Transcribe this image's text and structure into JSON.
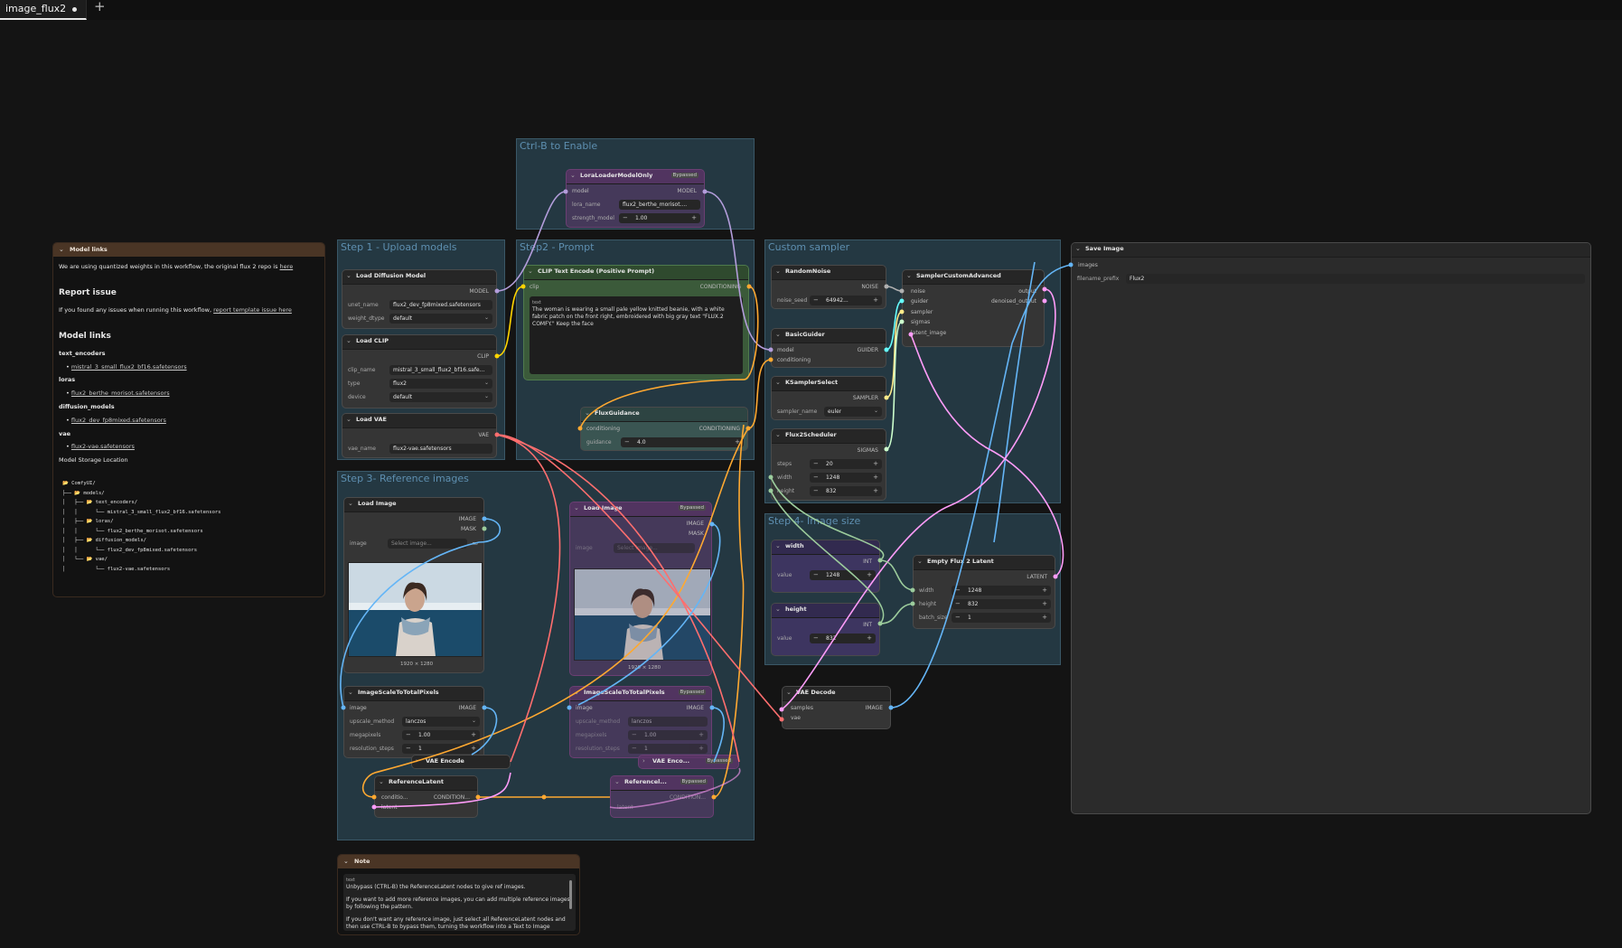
{
  "tab": {
    "title": "image_flux2",
    "add": "+"
  },
  "groups": {
    "enable": "Ctrl-B to Enable",
    "step1": "Step 1 - Upload models",
    "step2": "Step2 - Prompt",
    "custom_sampler": "Custom sampler",
    "step3": "Step 3- Reference images",
    "step4": "Step 4- Image size"
  },
  "model_links_note": {
    "title": "Model links",
    "intro_pre": "We are using quantized weights in this workflow, the original flux 2 repo is",
    "intro_link": "here",
    "report_heading": "Report issue",
    "report_pre": "If you found any issues when running this workflow,",
    "report_link": "report template issue here",
    "links_heading": "Model links",
    "text_encoders_label": "text_encoders",
    "text_encoders_file": "mistral_3_small_flux2_bf16.safetensors",
    "loras_label": "loras",
    "loras_file": "flux2_berthe_morisot.safetensors",
    "diffusion_label": "diffusion_models",
    "diffusion_file": "flux2_dev_fp8mixed.safetensors",
    "vae_label": "vae",
    "vae_file": "flux2-vae.safetensors",
    "storage_label": "Model Storage Location",
    "tree": "📂 ComfyUI/\n├── 📂 models/\n│   ├── 📂 text_encoders/\n│   │      └── mistral_3_small_flux2_bf16.safetensors\n│   ├── 📂 loras/\n│   │      └── flux2_berthe_morisot.safetensors\n│   ├── 📂 diffusion_models/\n│   │      └── flux2_dev_fp8mixed.safetensors\n│   └── 📂 vae/\n│          └── flux2-vae.safetensors"
  },
  "lora": {
    "title": "LoraLoaderModelOnly",
    "badge": "Bypassed",
    "in_model": "model",
    "out_model": "MODEL",
    "lora_name_label": "lora_name",
    "lora_name": "flux2_berthe_morisot....",
    "strength_label": "strength_model",
    "strength": "1.00"
  },
  "load_diffusion": {
    "title": "Load Diffusion Model",
    "out": "MODEL",
    "unet_label": "unet_name",
    "unet": "flux2_dev_fp8mixed.safetensors",
    "dtype_label": "weight_dtype",
    "dtype": "default"
  },
  "load_clip": {
    "title": "Load CLIP",
    "out": "CLIP",
    "name_label": "clip_name",
    "name": "mistral_3_small_flux2_bf16.safe...",
    "type_label": "type",
    "type": "flux2",
    "device_label": "device",
    "device": "default"
  },
  "load_vae": {
    "title": "Load VAE",
    "out": "VAE",
    "name_label": "vae_name",
    "name": "flux2-vae.safetensors"
  },
  "clip_text": {
    "title": "CLIP Text Encode (Positive Prompt)",
    "in": "clip",
    "out": "CONDITIONING",
    "text_label": "text",
    "text": "The woman is wearing a small pale yellow knitted beanie, with a white fabric patch on the front right, embroidered with big gray text \"FLUX.2 COMFY.\" Keep the face"
  },
  "flux_guidance": {
    "title": "FluxGuidance",
    "in": "conditioning",
    "out": "CONDITIONING",
    "label": "guidance",
    "value": "4.0"
  },
  "random_noise": {
    "title": "RandomNoise",
    "out": "NOISE",
    "label": "noise_seed",
    "value": "64942..."
  },
  "basic_guider": {
    "title": "BasicGuider",
    "in_model": "model",
    "in_cond": "conditioning",
    "out": "GUIDER"
  },
  "ksampler_select": {
    "title": "KSamplerSelect",
    "out": "SAMPLER",
    "label": "sampler_name",
    "value": "euler"
  },
  "flux2_scheduler": {
    "title": "Flux2Scheduler",
    "out": "SIGMAS",
    "steps_label": "steps",
    "steps": "20",
    "width_label": "width",
    "width": "1248",
    "height_label": "height",
    "height": "832"
  },
  "sampler_adv": {
    "title": "SamplerCustomAdvanced",
    "in_noise": "noise",
    "in_guider": "guider",
    "in_sampler": "sampler",
    "in_sigmas": "sigmas",
    "in_latent": "latent_image",
    "out_output": "output",
    "out_denoised": "denoised_output"
  },
  "save_image": {
    "title": "Save Image",
    "in": "images",
    "prefix_label": "filename_prefix",
    "prefix": "Flux2"
  },
  "width_node": {
    "title": "width",
    "out": "INT",
    "label": "value",
    "value": "1248"
  },
  "height_node": {
    "title": "height",
    "out": "INT",
    "label": "value",
    "value": "832"
  },
  "empty_latent": {
    "title": "Empty Flux 2 Latent",
    "out": "LATENT",
    "width_label": "width",
    "width": "1248",
    "height_label": "height",
    "height": "832",
    "batch_label": "batch_size",
    "batch": "1"
  },
  "vae_decode": {
    "title": "VAE Decode",
    "in_samples": "samples",
    "in_vae": "vae",
    "out": "IMAGE"
  },
  "load_image1": {
    "title": "Load Image",
    "out_image": "IMAGE",
    "out_mask": "MASK",
    "image_label": "image",
    "image_placeholder": "Select image...",
    "caption": "1920 × 1280"
  },
  "load_image2": {
    "title": "Load Image",
    "badge": "Bypassed",
    "out_image": "IMAGE",
    "out_mask": "MASK",
    "image_label": "image",
    "image_placeholder": "Select image...",
    "caption": "1920 × 1280"
  },
  "scale1": {
    "title": "ImageScaleToTotalPixels",
    "in": "image",
    "out": "IMAGE",
    "method_label": "upscale_method",
    "method": "lanczos",
    "mp_label": "megapixels",
    "mp": "1.00",
    "steps_label": "resolution_steps",
    "steps": "1"
  },
  "scale2": {
    "title": "ImageScaleToTotalPixels",
    "badge": "Bypassed",
    "in": "image",
    "out": "IMAGE",
    "method_label": "upscale_method",
    "method": "lanczos",
    "mp_label": "megapixels",
    "mp": "1.00",
    "steps_label": "resolution_steps",
    "steps": "1"
  },
  "vae_encode1": {
    "title": "VAE Encode"
  },
  "vae_encode2": {
    "title": "VAE Enco...",
    "badge": "Bypassed"
  },
  "ref_latent1": {
    "title": "ReferenceLatent",
    "in_cond": "conditio...",
    "in_latent": "latent",
    "out": "CONDITION..."
  },
  "ref_latent2": {
    "title": "Referencel...",
    "badge": "Bypassed",
    "in_latent": "latent",
    "out": "CONDITION..."
  },
  "note2": {
    "title": "Note",
    "text_label": "text",
    "line1": "Unbypass (CTRL-B) the ReferenceLatent nodes to give ref images.",
    "line2": "If you want to add more reference images, you can add multiple reference images by following the pattern.",
    "line3": "If you don't want any reference image, just select all ReferenceLatent nodes and then use CTRL-B to bypass them, turning the workflow into a Text to Image"
  },
  "colors": {
    "model": "#b39ddb",
    "clip": "#ffd500",
    "vae": "#ff6e6e",
    "conditioning": "#ffa931",
    "image": "#64b5f6",
    "latent": "#ff9cf9",
    "int": "#9ccc9c",
    "noise": "#b0b0b0",
    "guider": "#66ffff",
    "sampler": "#ffeb8a",
    "sigmas": "#cdffcd"
  }
}
